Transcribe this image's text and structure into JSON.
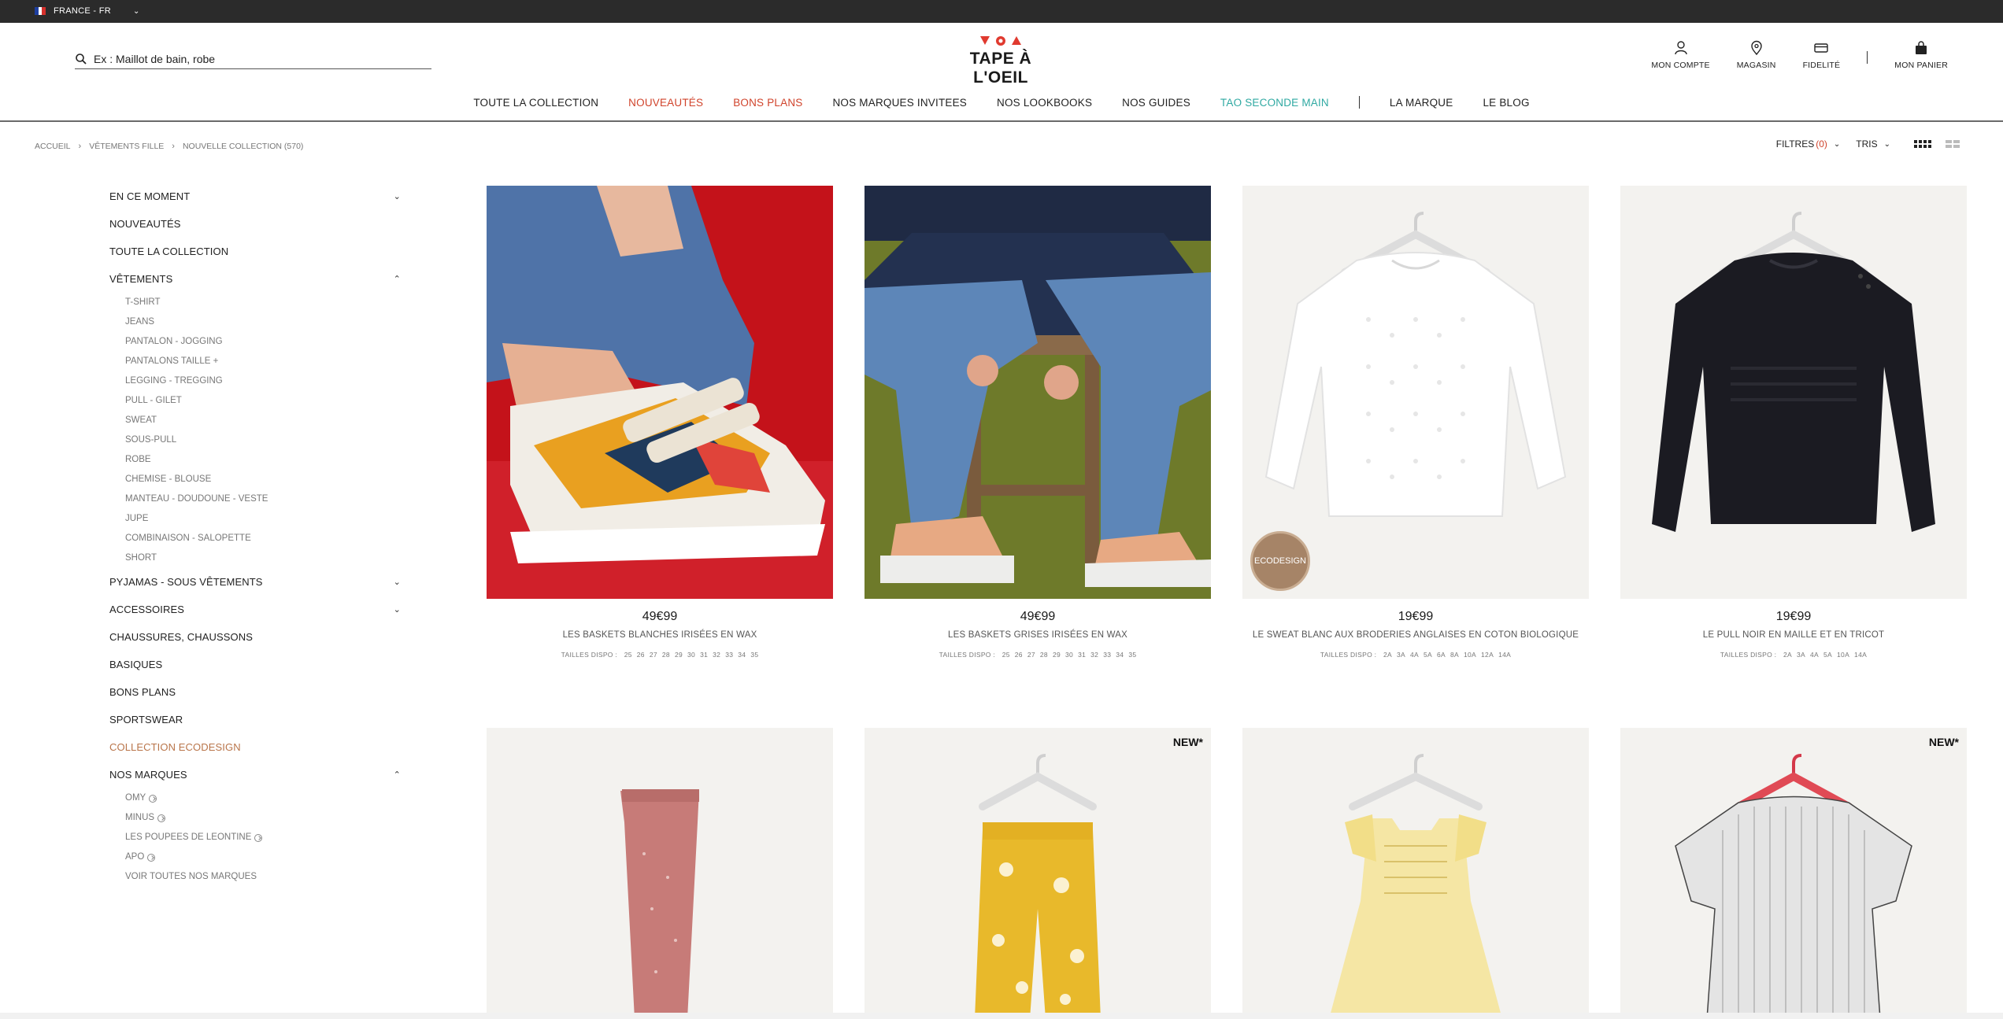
{
  "topbar": {
    "country": "FRANCE - FR"
  },
  "search": {
    "placeholder": "Ex : Maillot de bain, robe"
  },
  "logo": {
    "text": "TAPE À L'OEIL"
  },
  "actions": [
    {
      "label": "MON COMPTE",
      "icon": "account-icon"
    },
    {
      "label": "MAGASIN",
      "icon": "store-pin-icon"
    },
    {
      "label": "FIDELITÉ",
      "icon": "loyalty-card-icon"
    },
    {
      "label": "MON PANIER",
      "icon": "cart-bag-icon"
    }
  ],
  "nav": [
    {
      "label": "TOUTE LA COLLECTION",
      "color": "default"
    },
    {
      "label": "NOUVEAUTÉS",
      "color": "#d0432b"
    },
    {
      "label": "BONS PLANS",
      "color": "#d0432b"
    },
    {
      "label": "NOS MARQUES INVITEES",
      "color": "default"
    },
    {
      "label": "NOS LOOKBOOKS",
      "color": "default"
    },
    {
      "label": "NOS GUIDES",
      "color": "default"
    },
    {
      "label": "TAO SECONDE MAIN",
      "color": "#2fa9a2"
    },
    {
      "label": "LA MARQUE",
      "color": "default"
    },
    {
      "label": "LE BLOG",
      "color": "default"
    }
  ],
  "breadcrumb": [
    "ACCUEIL",
    "VÊTEMENTS FILLE",
    "NOUVELLE COLLECTION (570)"
  ],
  "toolbar": {
    "filters_label": "FILTRES",
    "filters_count": "(0)",
    "sort_label": "TRIS"
  },
  "sidebar": {
    "categories": [
      {
        "label": "EN CE MOMENT",
        "arrow": "down"
      },
      {
        "label": "NOUVEAUTÉS"
      },
      {
        "label": "TOUTE LA COLLECTION"
      },
      {
        "label": "VÊTEMENTS",
        "arrow": "up",
        "subs": [
          "T-SHIRT",
          "JEANS",
          "PANTALON - JOGGING",
          "PANTALONS TAILLE +",
          "LEGGING - TREGGING",
          "PULL - GILET",
          "SWEAT",
          "SOUS-PULL",
          "ROBE",
          "CHEMISE - BLOUSE",
          "MANTEAU - DOUDOUNE - VESTE",
          "JUPE",
          "COMBINAISON - SALOPETTE",
          "SHORT"
        ]
      },
      {
        "label": "PYJAMAS - SOUS VÊTEMENTS",
        "arrow": "down"
      },
      {
        "label": "ACCESSOIRES",
        "arrow": "down"
      },
      {
        "label": "CHAUSSURES, CHAUSSONS"
      },
      {
        "label": "BASIQUES"
      },
      {
        "label": "BONS PLANS"
      },
      {
        "label": "SPORTSWEAR"
      },
      {
        "label": "COLLECTION ECODESIGN",
        "color": "#b9754a"
      },
      {
        "label": "NOS MARQUES",
        "arrow": "up",
        "subs": [
          "OMY",
          "MINUS",
          "LES POUPEES DE LEONTINE",
          "APO",
          "VOIR TOUTES NOS MARQUES"
        ]
      }
    ]
  },
  "products": [
    {
      "price": "49€99",
      "name": "LES BASKETS BLANCHES IRISÉES EN WAX",
      "sizes_label": "TAILLES DISPO :",
      "sizes": [
        "25",
        "26",
        "27",
        "28",
        "29",
        "30",
        "31",
        "32",
        "33",
        "34",
        "35"
      ]
    },
    {
      "price": "49€99",
      "name": "LES BASKETS GRISES IRISÉES EN WAX",
      "sizes_label": "TAILLES DISPO :",
      "sizes": [
        "25",
        "26",
        "27",
        "28",
        "29",
        "30",
        "31",
        "32",
        "33",
        "34",
        "35"
      ]
    },
    {
      "price": "19€99",
      "name": "LE SWEAT BLANC AUX BRODERIES ANGLAISES EN COTON BIOLOGIQUE",
      "sizes_label": "TAILLES DISPO :",
      "sizes": [
        "2A",
        "3A",
        "4A",
        "5A",
        "6A",
        "8A",
        "10A",
        "12A",
        "14A"
      ],
      "badge": "ECODESIGN"
    },
    {
      "price": "19€99",
      "name": "LE PULL NOIR EN MAILLE ET EN TRICOT",
      "sizes_label": "TAILLES DISPO :",
      "sizes": [
        "2A",
        "3A",
        "4A",
        "5A",
        "10A",
        "14A"
      ]
    },
    {
      "new_label": ""
    },
    {
      "new_label": "NEW*"
    },
    {
      "new_label": ""
    },
    {
      "new_label": "NEW*"
    }
  ]
}
